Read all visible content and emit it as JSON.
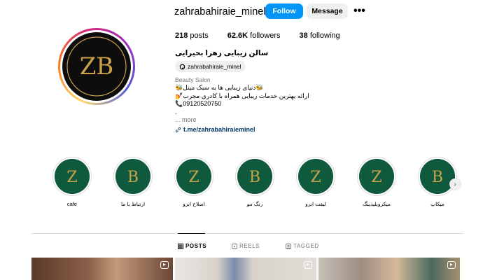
{
  "profile": {
    "username": "zahrabahiraie_minel",
    "follow_label": "Follow",
    "message_label": "Message",
    "more_label": "•••",
    "display_name": "سالن زیبایی زهرا بحیرایی",
    "threads_handle": "zahrabahiraie_minel",
    "category": "Beauty Salon",
    "bio_lines": [
      "🐝دنیای زیبایی ها به سبک مینل🐝",
      "💅ارائه بهترین خدمات زیبایی همراه با کادری مجرب",
      "📞09120520750",
      "."
    ],
    "bio_more": "... more",
    "link": "t.me/zahrabahiraieminel"
  },
  "stats": {
    "posts": {
      "value": "218",
      "label": "posts"
    },
    "followers": {
      "value": "62.6K",
      "label": "followers"
    },
    "following": {
      "value": "38",
      "label": "following"
    }
  },
  "highlights": [
    {
      "label": "cafe",
      "letter": "Z"
    },
    {
      "label": "ارتباط با ما",
      "letter": "B"
    },
    {
      "label": "اصلاح ابرو",
      "letter": "Z"
    },
    {
      "label": "رنگ مو",
      "letter": "B"
    },
    {
      "label": "لیفت ابرو",
      "letter": "Z"
    },
    {
      "label": "میکروبلیدینگ",
      "letter": "Z"
    },
    {
      "label": "میکاپ",
      "letter": "B"
    }
  ],
  "tabs": [
    {
      "label": "POSTS",
      "icon": "grid-icon",
      "active": true
    },
    {
      "label": "REELS",
      "icon": "reels-icon",
      "active": false
    },
    {
      "label": "TAGGED",
      "icon": "tagged-icon",
      "active": false
    }
  ],
  "colors": {
    "accent_blue": "#0095f6",
    "highlight_green": "#0f5a3c",
    "gold": "#c9a24a"
  }
}
